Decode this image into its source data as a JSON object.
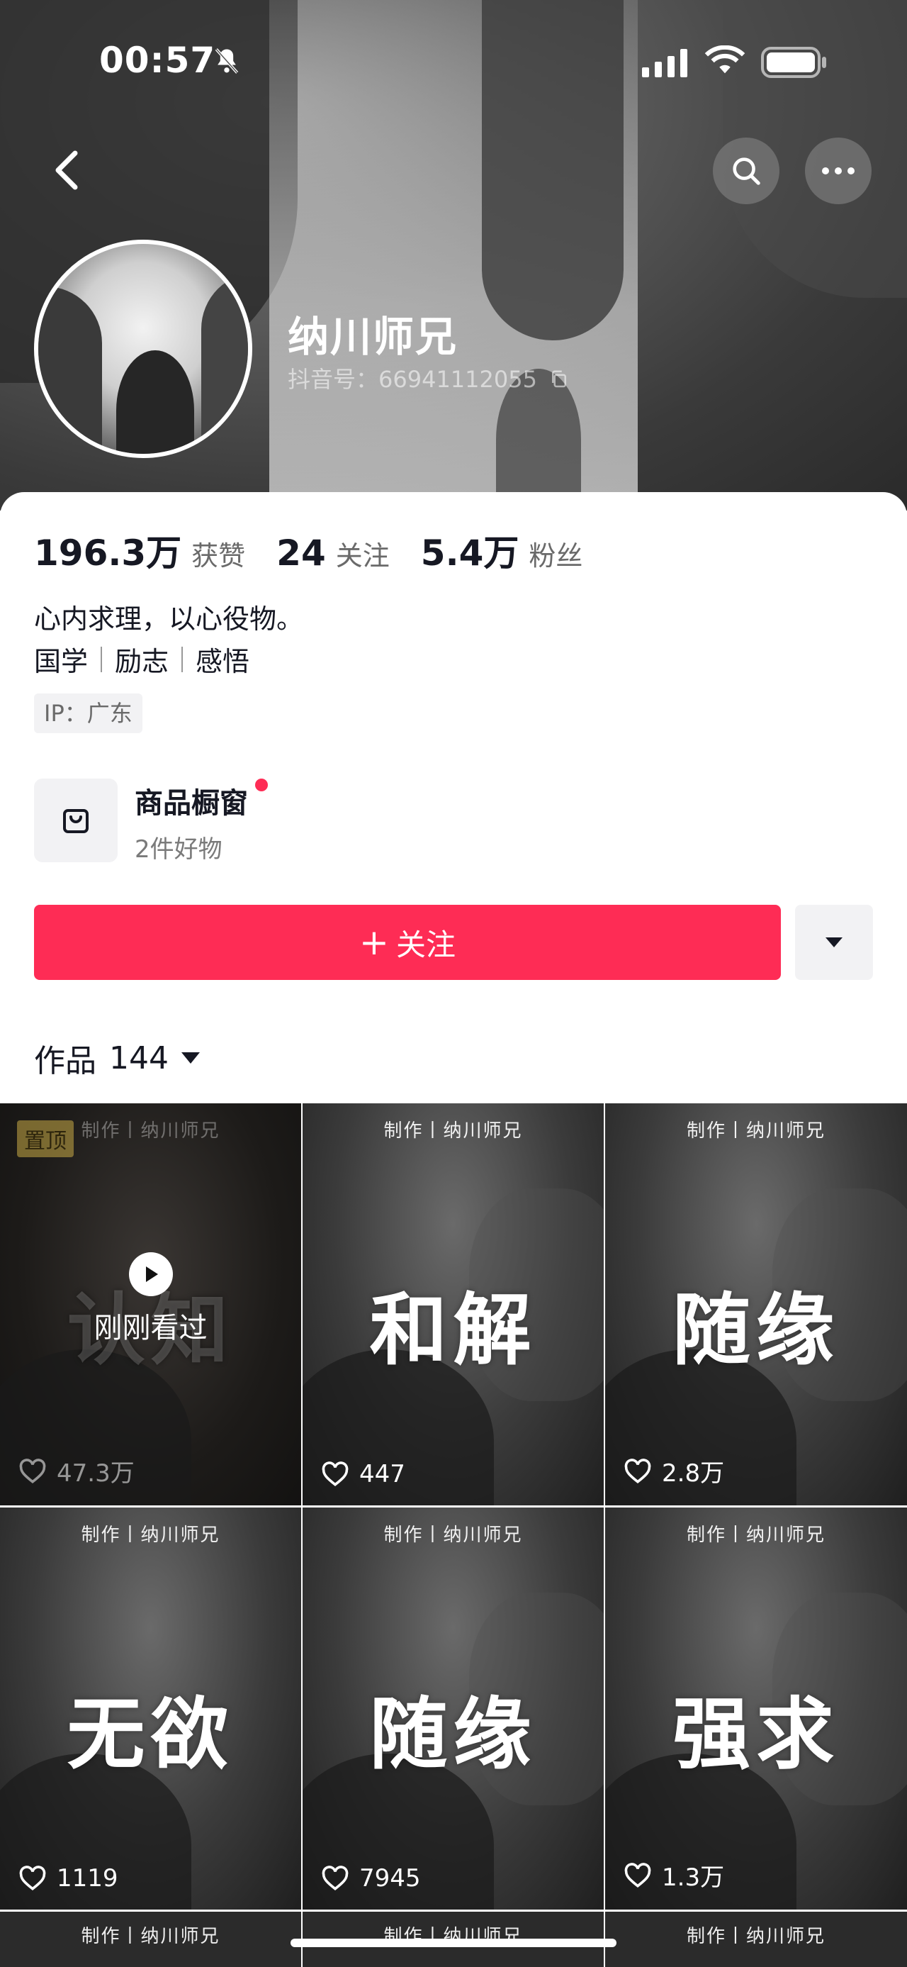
{
  "status_bar": {
    "time": "00:57"
  },
  "profile": {
    "name": "纳川师兄",
    "douyin_id": "抖音号：66941112055",
    "stats": [
      {
        "value": "196.3万",
        "label": "获赞"
      },
      {
        "value": "24",
        "label": "关注"
      },
      {
        "value": "5.4万",
        "label": "粉丝"
      }
    ],
    "bio": "心内求理，以心役物。",
    "tags": [
      "国学",
      "励志",
      "感悟"
    ],
    "ip": "IP：广东"
  },
  "shop": {
    "title": "商品橱窗",
    "subtitle": "2件好物"
  },
  "actions": {
    "follow_label": "关注",
    "follow_plus": "+"
  },
  "works": {
    "label": "作品",
    "count": "144"
  },
  "videos": [
    {
      "credit": "制作丨纳川师兄",
      "title": "认知",
      "likes": "47.3万",
      "pinned": "置顶",
      "overlay": "刚刚看过"
    },
    {
      "credit": "制作丨纳川师兄",
      "title": "和解",
      "likes": "447"
    },
    {
      "credit": "制作丨纳川师兄",
      "title": "随缘",
      "likes": "2.8万"
    },
    {
      "credit": "制作丨纳川师兄",
      "title": "无欲",
      "likes": "1119"
    },
    {
      "credit": "制作丨纳川师兄",
      "title": "随缘",
      "likes": "7945"
    },
    {
      "credit": "制作丨纳川师兄",
      "title": "强求",
      "likes": "1.3万"
    }
  ],
  "peek_credits": [
    "制作丨纳川师兄",
    "制作丨纳川师兄",
    "制作丨纳川师兄"
  ],
  "colors": {
    "accent": "#fe2c55",
    "text": "#161823",
    "muted": "#6a6a6a"
  },
  "icons": [
    "back-icon",
    "search-icon",
    "more-icon",
    "bell-mute-icon",
    "signal-icon",
    "wifi-icon",
    "battery-icon",
    "copy-icon",
    "shop-bag-icon",
    "caret-down-icon",
    "heart-icon",
    "play-icon"
  ]
}
